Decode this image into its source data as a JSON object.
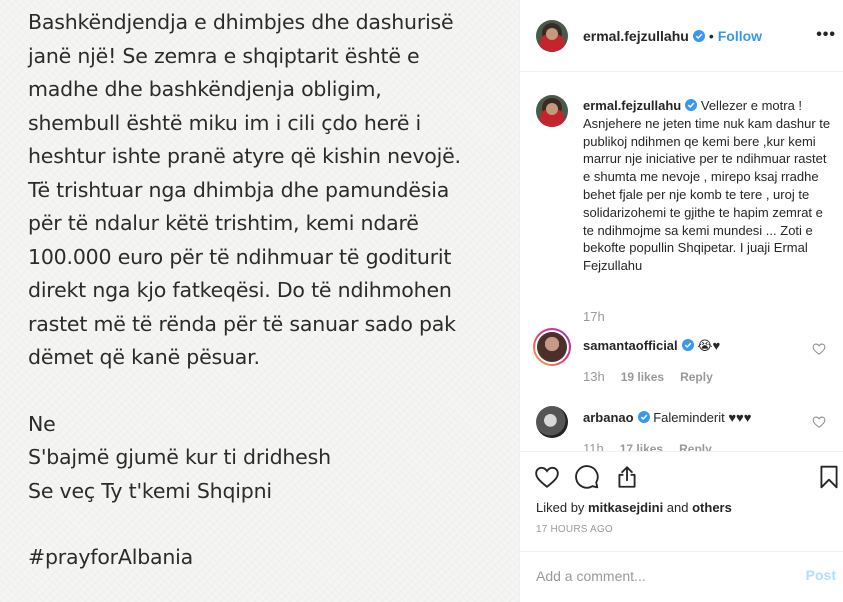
{
  "post_image": {
    "paragraph1": "Bashkëndjendja e dhimbjes dhe dashurisë\njanë një! Se zemra e shqiptarit është e\nmadhe dhe bashkëndjenja obligim,\nshembull është miku im i cili çdo herë i\nheshtur ishte pranë atyre që kishin nevojë.\nTë trishtuar nga dhimbja dhe pamundësia\npër të ndalur këtë trishtim, kemi ndarë\n100.000 euro për të ndihmuar të goditurit\ndirekt nga kjo fatkeqësi. Do të ndihmohen\nrastet më të rënda për të sanuar sado pak\ndëmet që kanë pësuar.",
    "paragraph2": "Ne\nS'bajmë gjumë kur ti dridhesh\nSe veç Ty t'kemi Shqipni",
    "hashtag": "#prayforAlbania"
  },
  "header": {
    "username": "ermal.fejzullahu",
    "separator": "•",
    "follow_label": "Follow",
    "more_label": "•••"
  },
  "caption": {
    "username": "ermal.fejzullahu",
    "text": "Vellezer e motra ! Asnjehere ne jeten time nuk kam dashur te publikoj ndihmen qe kemi bere ,kur kemi marrur nje iniciative per te ndihmuar rastet e shumta me nevoje , mirepo ksaj rradhe behet fjale per nje komb te tere , uroj te solidarizohemi te gjithe te hapim zemrat e te ndihmojme sa kemi mundesi ... Zoti e bekofte popullin Shqipetar. I juaji Ermal Fejzullahu",
    "time": "17h"
  },
  "comments": [
    {
      "username": "samantaofficial",
      "text": "😭♥",
      "time": "13h",
      "likes": "19 likes",
      "reply": "Reply"
    },
    {
      "username": "arbanao",
      "text": "Faleminderit ♥♥♥",
      "time": "11h",
      "likes": "17 likes",
      "reply": "Reply"
    }
  ],
  "actions": {
    "liked_by_prefix": "Liked by ",
    "liked_by_user": "mitkasejdini",
    "liked_by_and": " and ",
    "liked_by_others": "others",
    "posted_ago": "17 HOURS AGO"
  },
  "add_comment": {
    "placeholder": "Add a comment...",
    "post_label": "Post"
  },
  "colors": {
    "accent": "#3897f0",
    "post_disabled": "#b2dffc",
    "muted": "#999999",
    "text": "#262626"
  }
}
